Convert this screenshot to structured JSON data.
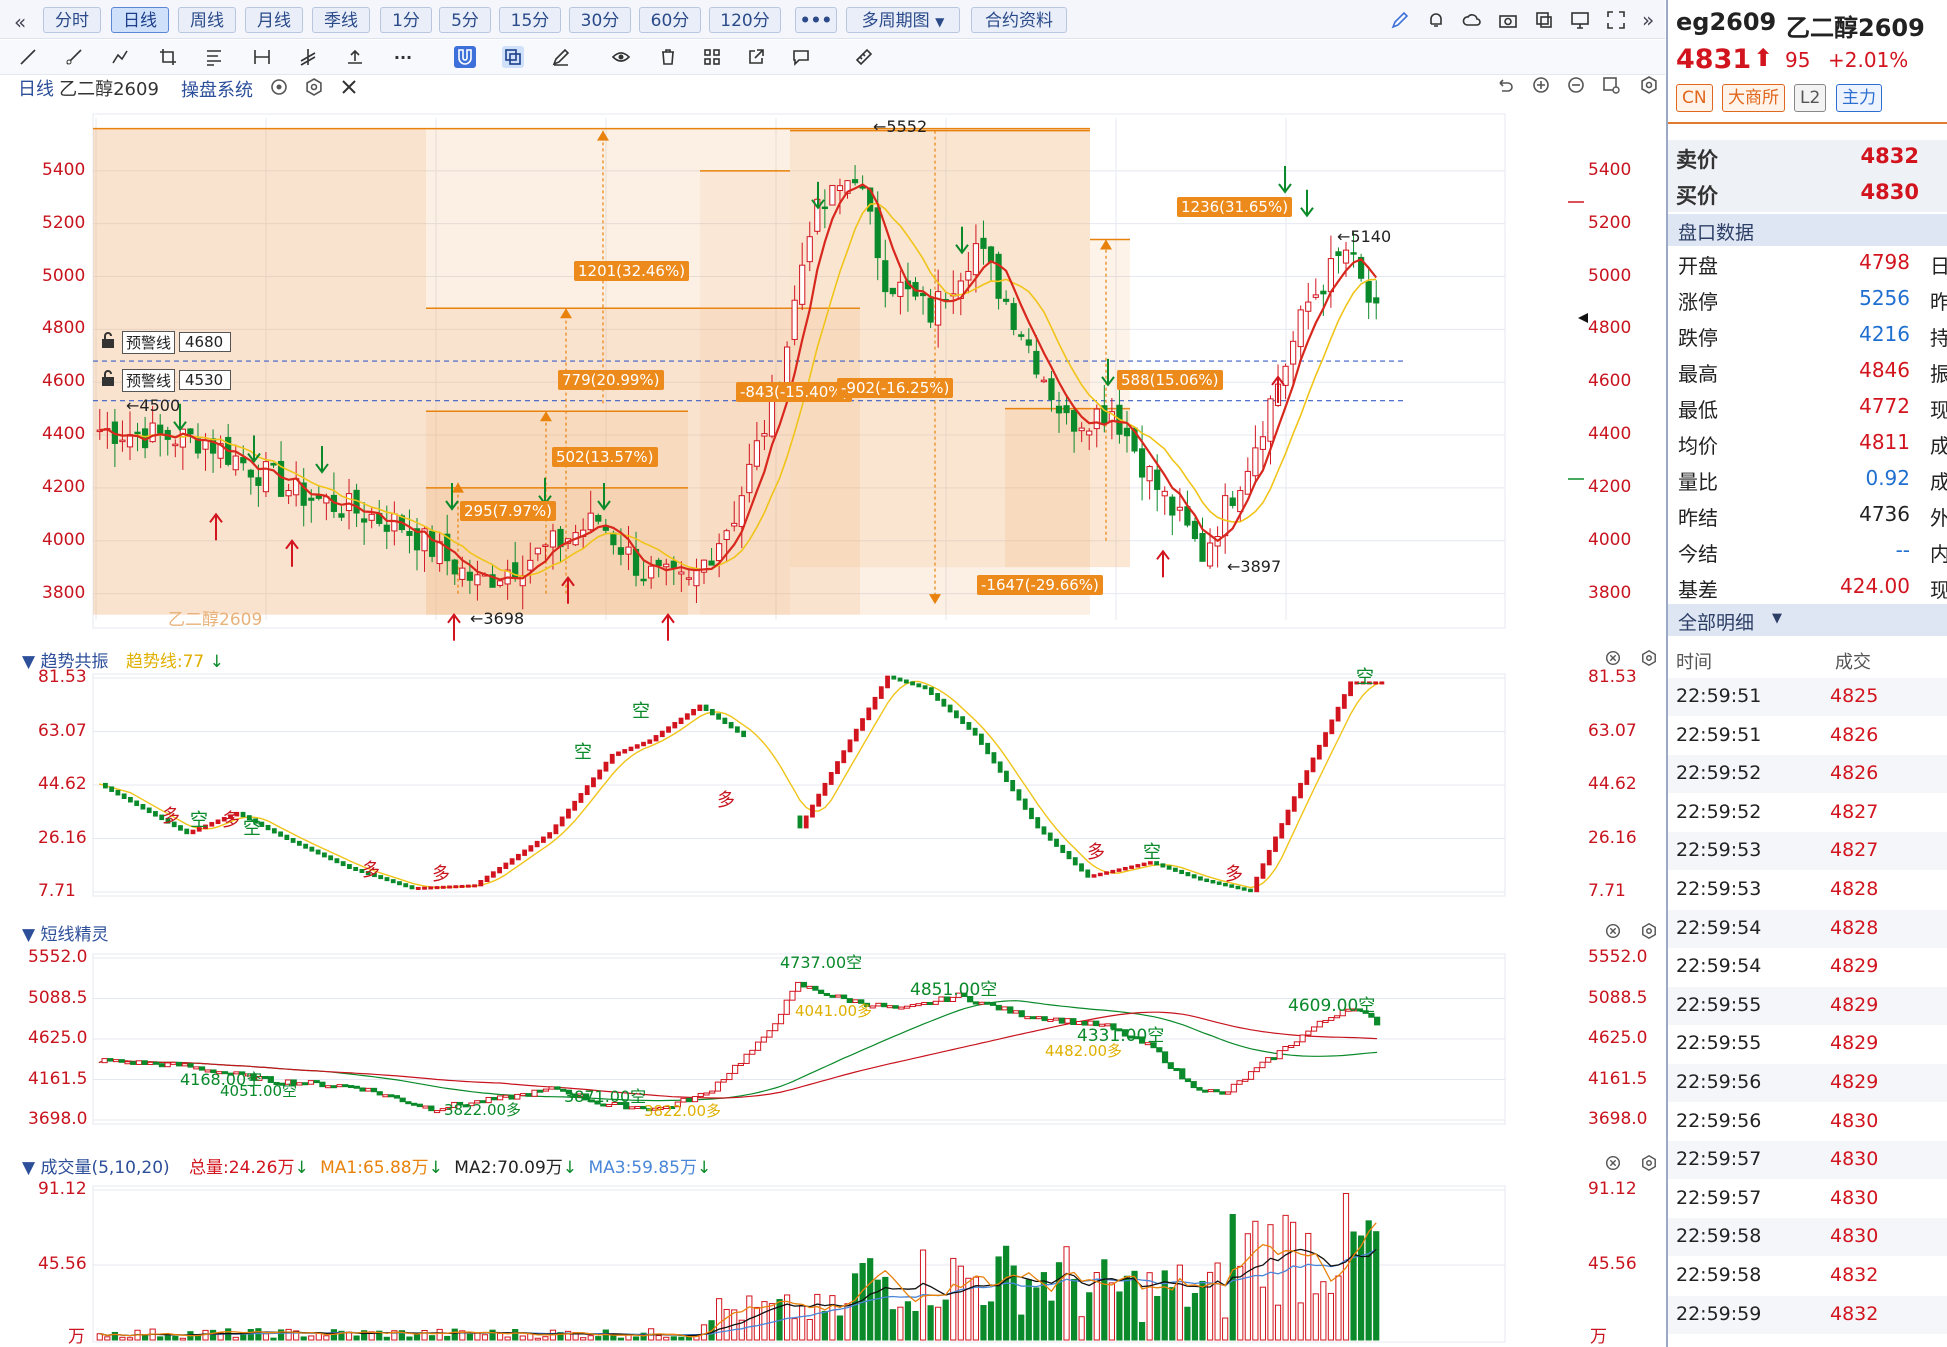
{
  "toolbar": {
    "collapse_icon": "double-chevron-left-icon",
    "periods": [
      "分时",
      "日线",
      "周线",
      "月线",
      "季线",
      "1分",
      "5分",
      "15分",
      "30分",
      "60分",
      "120分"
    ],
    "active_period": "日线",
    "more_label": "•••",
    "multi_period_label": "多周期图",
    "contract_info_label": "合约资料",
    "right_icons": [
      "pen-icon",
      "bell-icon",
      "cloud-icon",
      "camera-icon",
      "window-icon",
      "monitor-icon",
      "fullscreen-icon",
      "double-chevron-right-icon"
    ]
  },
  "drawing_tools": [
    "line-tool-icon",
    "ray-tool-icon",
    "polyline-tool-icon",
    "crop-tool-icon",
    "fib-tool-icon",
    "range-tool-icon",
    "channel-tool-icon",
    "level-tool-icon",
    "more-tools-icon",
    "magnet-icon",
    "layers-icon",
    "brush-icon",
    "eye-icon",
    "trash-icon",
    "grid-icon",
    "share-icon",
    "comment-icon",
    "ruler-icon"
  ],
  "main_chart": {
    "title": "日线",
    "symbol_name": "乙二醇2609",
    "system_label": "操盘系统",
    "watermark": "乙二醇2609",
    "y_ticks": [
      "5400",
      "5200",
      "5000",
      "4800",
      "4600",
      "4400",
      "4200",
      "4000",
      "3800"
    ],
    "y_min": 3700,
    "y_max": 5600,
    "warning_lines": [
      {
        "label": "预警线",
        "value": "4680"
      },
      {
        "label": "预警线",
        "value": "4530"
      }
    ],
    "extreme_labels": [
      "←4500",
      "←5552",
      "←3698",
      "←5140",
      "←3897"
    ],
    "swing_labels": [
      "295(7.97%)",
      "502(13.57%)",
      "779(20.99%)",
      "1201(32.46%)",
      "-843(-15.40%)",
      "-902(-16.25%)",
      "-1647(-29.66%)",
      "588(15.06%)",
      "1236(31.65%)"
    ],
    "right_icons": [
      "undo-icon",
      "zoom-in-icon",
      "zoom-out-icon",
      "settings-square-icon",
      "gear-icon"
    ]
  },
  "trend_panel": {
    "title": "趋势共振",
    "sub": "趋势线:77",
    "y_ticks": [
      "81.53",
      "63.07",
      "44.62",
      "26.16",
      "7.71"
    ],
    "marks": [
      "多",
      "空"
    ]
  },
  "sprite_panel": {
    "title": "短线精灵",
    "y_ticks": [
      "5552.0",
      "5088.5",
      "4625.0",
      "4161.5",
      "3698.0"
    ],
    "annotations": [
      "4737.00空",
      "4851.00空",
      "4331.00空",
      "4609.00空",
      "4168.00空",
      "4051.00空",
      "3871.00空",
      "3822.00多",
      "4041.00多",
      "4482.00多",
      "3822.00多"
    ]
  },
  "volume_panel": {
    "title": "成交量(5,10,20)",
    "total": "总量:24.26万",
    "ma1": "MA1:65.88万",
    "ma2": "MA2:70.09万",
    "ma3": "MA3:59.85万",
    "y_ticks": [
      "91.12",
      "45.56",
      "万"
    ]
  },
  "quote": {
    "code": "eg2609",
    "name": "乙二醇2609",
    "price": "4831",
    "change": "95",
    "change_pct": "+2.01%",
    "badges": [
      "CN",
      "大商所",
      "L2",
      "主力"
    ],
    "ask_label": "卖价",
    "ask": "4832",
    "bid_label": "买价",
    "bid": "4830",
    "section_label": "盘口数据",
    "rows": [
      {
        "label": "开盘",
        "value": "4798",
        "right": "日",
        "color": "#d2141e"
      },
      {
        "label": "涨停",
        "value": "5256",
        "right": "昨",
        "color": "#1f6fd0"
      },
      {
        "label": "跌停",
        "value": "4216",
        "right": "持",
        "color": "#1f6fd0"
      },
      {
        "label": "最高",
        "value": "4846",
        "right": "振",
        "color": "#d2141e"
      },
      {
        "label": "最低",
        "value": "4772",
        "right": "现",
        "color": "#d2141e"
      },
      {
        "label": "均价",
        "value": "4811",
        "right": "成",
        "color": "#d2141e"
      },
      {
        "label": "量比",
        "value": "0.92",
        "right": "成",
        "color": "#1f6fd0"
      },
      {
        "label": "昨结",
        "value": "4736",
        "right": "外",
        "color": "#222222"
      },
      {
        "label": "今结",
        "value": "--",
        "right": "内",
        "color": "#1f6fd0"
      },
      {
        "label": "基差",
        "value": "424.00",
        "right": "现",
        "color": "#d2141e"
      }
    ],
    "detail_label": "全部明细",
    "detail_col_time": "时间",
    "detail_col_price": "成交",
    "ticks": [
      {
        "time": "22:59:51",
        "price": "4825"
      },
      {
        "time": "22:59:51",
        "price": "4826"
      },
      {
        "time": "22:59:52",
        "price": "4826"
      },
      {
        "time": "22:59:52",
        "price": "4827"
      },
      {
        "time": "22:59:53",
        "price": "4827"
      },
      {
        "time": "22:59:53",
        "price": "4828"
      },
      {
        "time": "22:59:54",
        "price": "4828"
      },
      {
        "time": "22:59:54",
        "price": "4829"
      },
      {
        "time": "22:59:55",
        "price": "4829"
      },
      {
        "time": "22:59:55",
        "price": "4829"
      },
      {
        "time": "22:59:56",
        "price": "4829"
      },
      {
        "time": "22:59:56",
        "price": "4830"
      },
      {
        "time": "22:59:57",
        "price": "4830"
      },
      {
        "time": "22:59:57",
        "price": "4830"
      },
      {
        "time": "22:59:58",
        "price": "4830"
      },
      {
        "time": "22:59:58",
        "price": "4832"
      },
      {
        "time": "22:59:59",
        "price": "4832"
      }
    ]
  },
  "colors": {
    "up": "#d2141e",
    "down": "#0a8a2a",
    "orange": "#e8820c",
    "ma_yellow": "#f0c419",
    "grid": "#e4e8f0",
    "panel_title": "#2d4f9a"
  }
}
